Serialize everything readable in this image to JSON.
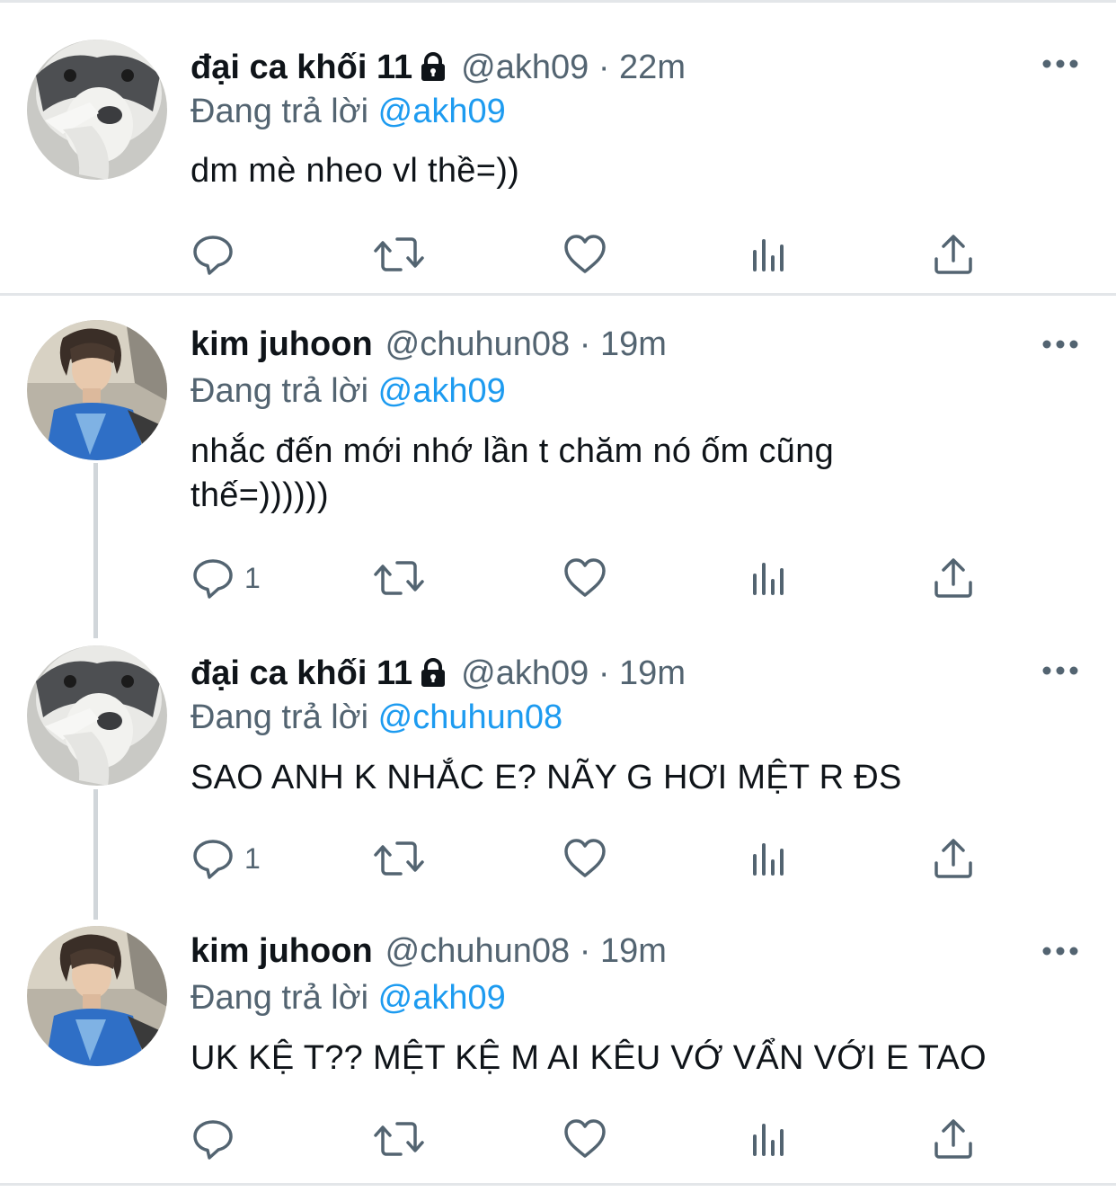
{
  "tweets": [
    {
      "name": "đại ca khối 11",
      "locked": true,
      "handle": "@akh09",
      "dot": "·",
      "time": "22m",
      "replying_prefix": "Đang trả lời",
      "replying_to": "@akh09",
      "text": "dm mè nheo vl thề=))",
      "reply_count": "",
      "avatar": "husky-pointing"
    },
    {
      "name": "kim juhoon",
      "locked": false,
      "handle": "@chuhun08",
      "dot": "·",
      "time": "19m",
      "replying_prefix": "Đang trả lời",
      "replying_to": "@akh09",
      "text": "nhắc đến mới nhớ lần t chăm nó ốm cũng thế=))))))",
      "reply_count": "1",
      "avatar": "person-blue-shirt"
    },
    {
      "name": "đại ca khối 11",
      "locked": true,
      "handle": "@akh09",
      "dot": "·",
      "time": "19m",
      "replying_prefix": "Đang trả lời",
      "replying_to": "@chuhun08",
      "text": "SAO ANH K NHẮC E? NÃY G HƠI MỆT R ĐS",
      "reply_count": "1",
      "avatar": "husky-pointing"
    },
    {
      "name": "kim juhoon",
      "locked": false,
      "handle": "@chuhun08",
      "dot": "·",
      "time": "19m",
      "replying_prefix": "Đang trả lời",
      "replying_to": "@akh09",
      "text": "UK KỆ T?? MỆT KỆ M AI KÊU VỚ VẨN VỚI E TAO",
      "reply_count": "",
      "avatar": "person-blue-shirt"
    }
  ],
  "icons": {
    "reply": "reply-bubble-icon",
    "retweet": "retweet-icon",
    "like": "heart-icon",
    "views": "views-bar-icon",
    "share": "share-upload-icon",
    "more": "more-dots-icon",
    "lock": "lock-icon"
  },
  "colors": {
    "text": "#0f1419",
    "muted": "#536471",
    "mention": "#1d9bf0",
    "separator": "#e3e6e9",
    "thread_line": "#d1d6da"
  }
}
